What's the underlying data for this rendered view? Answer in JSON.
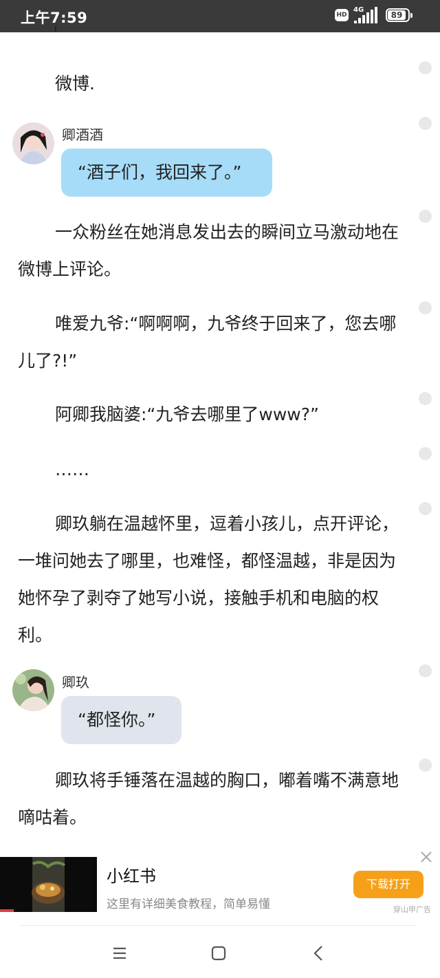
{
  "status_bar": {
    "time": "上午7:59",
    "hd_badge": "HD",
    "network": "4G",
    "battery": "89"
  },
  "content": {
    "para_weibo": "微博.",
    "chat_1": {
      "name": "卿酒酒",
      "message": "“酒子们，我回来了。”"
    },
    "para_2": "一众粉丝在她消息发出去的瞬间立马激动地在微博上评论。",
    "para_3": "唯爱九爷:“啊啊啊，九爷终于回来了，您去哪儿了?!”",
    "para_4": "阿卿我脑婆:“九爷去哪里了www?”",
    "para_5": "……",
    "para_6": "卿玖躺在温越怀里，逗着小孩儿，点开评论，一堆问她去了哪里，也难怪，都怪温越，非是因为她怀孕了剥夺了她写小说，接触手机和电脑的权利。",
    "chat_2": {
      "name": "卿玖",
      "message": "“都怪你。”"
    },
    "para_7": "卿玖将手锤落在温越的胸口，嘟着嘴不满意地嘀咕着。"
  },
  "ad": {
    "title": "小红书",
    "description": "这里有详细美食教程，简单易懂",
    "button_label": "下载打开",
    "ad_label": "穿山甲广告"
  },
  "colors": {
    "status_bar_bg": "#3a3a3a",
    "bubble_blue": "#a6dcf8",
    "bubble_gray": "#e0e5ed",
    "ad_button": "#f6a01a"
  }
}
